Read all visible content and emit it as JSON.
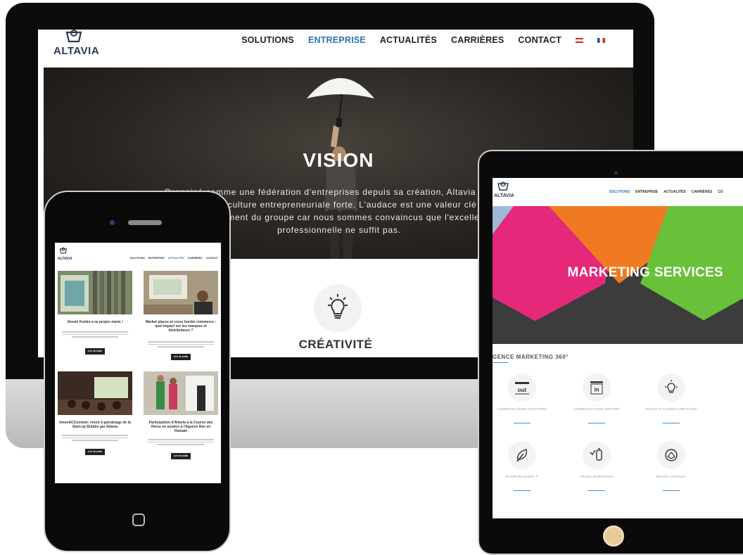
{
  "brand": {
    "logo_text": "ALTAVIA"
  },
  "desktop": {
    "nav": [
      {
        "label": "SOLUTIONS",
        "active": false
      },
      {
        "label": "ENTREPRISE",
        "active": true
      },
      {
        "label": "ACTUALITÉS",
        "active": false
      },
      {
        "label": "CARRIÈRES",
        "active": false
      },
      {
        "label": "CONTACT",
        "active": false
      }
    ],
    "hero_title": "VISION",
    "hero_text": "Organisé comme une fédération d'entreprises depuis sa création, Altavia a fait de son ADN une culture entrepreneuriale forte. L'audace est une valeur clé pour le développement du groupe car nous sommes convaincus que l'excellence professionnelle ne suffit pas.",
    "value_title": "CRÉATIVITÉ"
  },
  "phone": {
    "nav": [
      "SOLUTIONS",
      "ENTREPRISE",
      "ACTUALITÉS",
      "CARRIÈRES",
      "CONTACT"
    ],
    "active_index": 2,
    "cards": [
      {
        "title": "Jöosté Konbo a sa propre marte !",
        "button": "Lire la suite"
      },
      {
        "title": "Market places et cross border commerce : quel impact sur les marques et distributeurs ?",
        "button": "Lire la suite"
      },
      {
        "title": "InnovACCommet: renoir à parrainage de la Start-up Bubble par Altavia",
        "button": "Lire la suite"
      },
      {
        "title": "Participation d'Altavia à la Course des Héros en soutien à l'Agence Ren en Humain",
        "button": "Lire la suite"
      }
    ]
  },
  "tablet": {
    "nav": [
      "SOLUTIONS",
      "ENTREPRISE",
      "ACTUALITÉS",
      "CARRIÈRES",
      "CO"
    ],
    "active_index": 0,
    "hero_title": "MARKETING SERVICES",
    "subtitle": "GENCE MARKETING 360°",
    "services": [
      {
        "label": "COMMUNICATION OUTSTORE",
        "icon": "out-icon",
        "badge": "out"
      },
      {
        "label": "COMMUNICATION INSTORE",
        "icon": "in-icon",
        "badge": "in"
      },
      {
        "label": "INSIGHTS & IDÉES CRÉATIVES",
        "icon": "lightbulb-icon"
      },
      {
        "label": "ECOPUBLISHING ®",
        "icon": "leaf-icon"
      },
      {
        "label": "TRADE MARKETING",
        "icon": "product-icon"
      },
      {
        "label": "BRAND CONTENT",
        "icon": "brand-icon"
      }
    ],
    "colors": {
      "pink": "#e6287a",
      "orange": "#f07a21",
      "green": "#69c13a",
      "dark": "#3c3c3c"
    }
  }
}
